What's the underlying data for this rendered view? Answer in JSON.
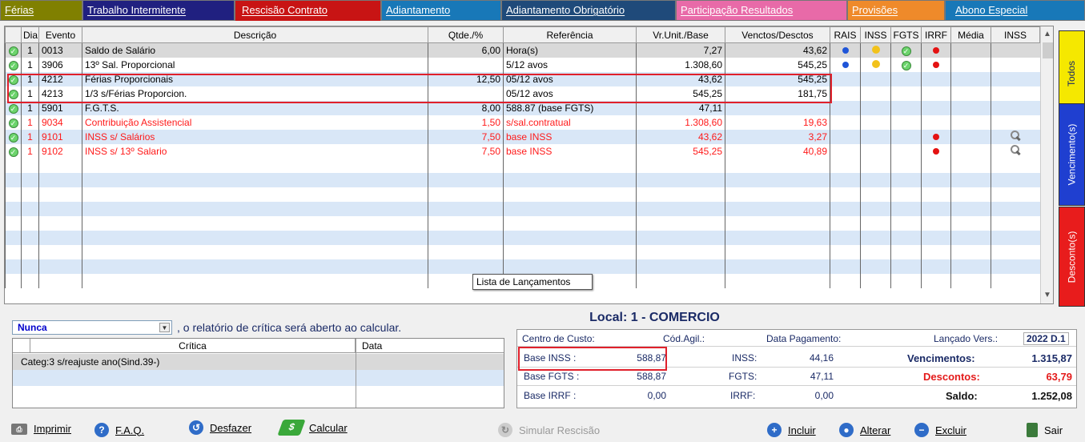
{
  "tabs": [
    {
      "label": "Férias",
      "bg": "#808000"
    },
    {
      "label": "Trabalho Intermitente",
      "bg": "#202080"
    },
    {
      "label": "Rescisão Contrato",
      "bg": "#c81414"
    },
    {
      "label": "Adiantamento",
      "bg": "#1878b8"
    },
    {
      "label": "Adiantamento Obrigatório",
      "bg": "#1f4a7a"
    },
    {
      "label": "Participação Resultados",
      "bg": "#e86aa8"
    },
    {
      "label": "Provisões",
      "bg": "#ef8a2a"
    },
    {
      "label": "Abono Especial",
      "bg": "#1878b8"
    }
  ],
  "grid": {
    "columns": [
      "",
      "Dia",
      "Evento",
      "Descrição",
      "Qtde./%",
      "Referência",
      "Vr.Unit./Base",
      "Venctos/Desctos",
      "RAIS",
      "INSS",
      "FGTS",
      "IRRF",
      "Média",
      "INSS"
    ],
    "rows": [
      {
        "dia": "1",
        "evento": "0013",
        "descricao": "Saldo de Salário",
        "qtde": "6,00",
        "referencia": "Hora(s)",
        "vr": "7,27",
        "venc": "43,62",
        "rais": "blue",
        "inss": "yellow",
        "fgts": "check",
        "irrf": "red",
        "inss2": "",
        "style": "gray"
      },
      {
        "dia": "1",
        "evento": "3906",
        "descricao": "13º Sal. Proporcional",
        "qtde": "",
        "referencia": "5/12 avos",
        "vr": "1.308,60",
        "venc": "545,25",
        "rais": "blue",
        "inss": "yellow",
        "fgts": "check",
        "irrf": "red",
        "inss2": "",
        "style": "even"
      },
      {
        "dia": "1",
        "evento": "4212",
        "descricao": "Férias Proporcionais",
        "qtde": "12,50",
        "referencia": "05/12 avos",
        "vr": "43,62",
        "venc": "545,25",
        "rais": "",
        "inss": "",
        "fgts": "",
        "irrf": "",
        "inss2": "",
        "style": "odd"
      },
      {
        "dia": "1",
        "evento": "4213",
        "descricao": "1/3 s/Férias Proporcion.",
        "qtde": "",
        "referencia": "05/12 avos",
        "vr": "545,25",
        "venc": "181,75",
        "rais": "",
        "inss": "",
        "fgts": "",
        "irrf": "",
        "inss2": "",
        "style": "even"
      },
      {
        "dia": "1",
        "evento": "5901",
        "descricao": "F.G.T.S.",
        "qtde": "8,00",
        "referencia": "588.87 (base FGTS)",
        "vr": "47,11",
        "venc": "",
        "rais": "",
        "inss": "",
        "fgts": "",
        "irrf": "",
        "inss2": "",
        "style": "odd"
      },
      {
        "dia": "1",
        "evento": "9034",
        "descricao": "Contribuição Assistencial",
        "qtde": "1,50",
        "referencia": "s/sal.contratual",
        "vr": "1.308,60",
        "venc": "19,63",
        "rais": "",
        "inss": "",
        "fgts": "",
        "irrf": "",
        "inss2": "",
        "style": "even red"
      },
      {
        "dia": "1",
        "evento": "9101",
        "descricao": "INSS s/ Salários",
        "qtde": "7,50",
        "referencia": "base INSS",
        "vr": "43,62",
        "venc": "3,27",
        "rais": "",
        "inss": "",
        "fgts": "",
        "irrf": "red",
        "inss2": "mag",
        "style": "odd red"
      },
      {
        "dia": "1",
        "evento": "9102",
        "descricao": "INSS s/ 13º Salario",
        "qtde": "7,50",
        "referencia": "base INSS",
        "vr": "545,25",
        "venc": "40,89",
        "rais": "",
        "inss": "",
        "fgts": "",
        "irrf": "red",
        "inss2": "mag",
        "style": "even red"
      }
    ],
    "empty_rows": 9
  },
  "tooltip": "Lista de Lançamentos",
  "side_tabs": [
    {
      "label": "Todos",
      "bg": "#f5e800",
      "color": "#1a2a66"
    },
    {
      "label": "Vencimento(s)",
      "bg": "#1f3fd0",
      "color": "#ffffff"
    },
    {
      "label": "Desconto(s)",
      "bg": "#e81c1c",
      "color": "#ffffff"
    }
  ],
  "critica": {
    "select_value": "Nunca",
    "text": ", o relatório de crítica será aberto ao calcular.",
    "col_critica": "Crítica",
    "col_data": "Data",
    "rows": [
      "Categ:3 s/reajuste ano(Sind.39-)"
    ]
  },
  "info": {
    "local": "Local: 1 - COMERCIO",
    "centro_custo": "Centro de Custo:",
    "cod_agil": "Cód.Agil.:",
    "data_pagamento": "Data Pagamento:",
    "lancado_vers": "Lançado Vers.:",
    "versao": "2022 D.1",
    "base_inss_label": "Base  INSS :",
    "base_inss": "588,87",
    "base_fgts_label": "Base FGTS :",
    "base_fgts": "588,87",
    "base_irrf_label": "Base  IRRF :",
    "base_irrf": "0,00",
    "inss_label": "INSS:",
    "inss": "44,16",
    "fgts_label": "FGTS:",
    "fgts": "47,11",
    "irrf_label": "IRRF:",
    "irrf": "0,00",
    "venc_label": "Vencimentos:",
    "venc": "1.315,87",
    "desc_label": "Descontos:",
    "desc": "63,79",
    "saldo_label": "Saldo:",
    "saldo": "1.252,08"
  },
  "buttons": {
    "imprimir": "Imprimir",
    "faq": "F.A.Q.",
    "desfazer": "Desfazer",
    "calcular": "Calcular",
    "simular": "Simular Rescisão",
    "incluir": "Incluir",
    "alterar": "Alterar",
    "excluir": "Excluir",
    "sair": "Sair"
  }
}
